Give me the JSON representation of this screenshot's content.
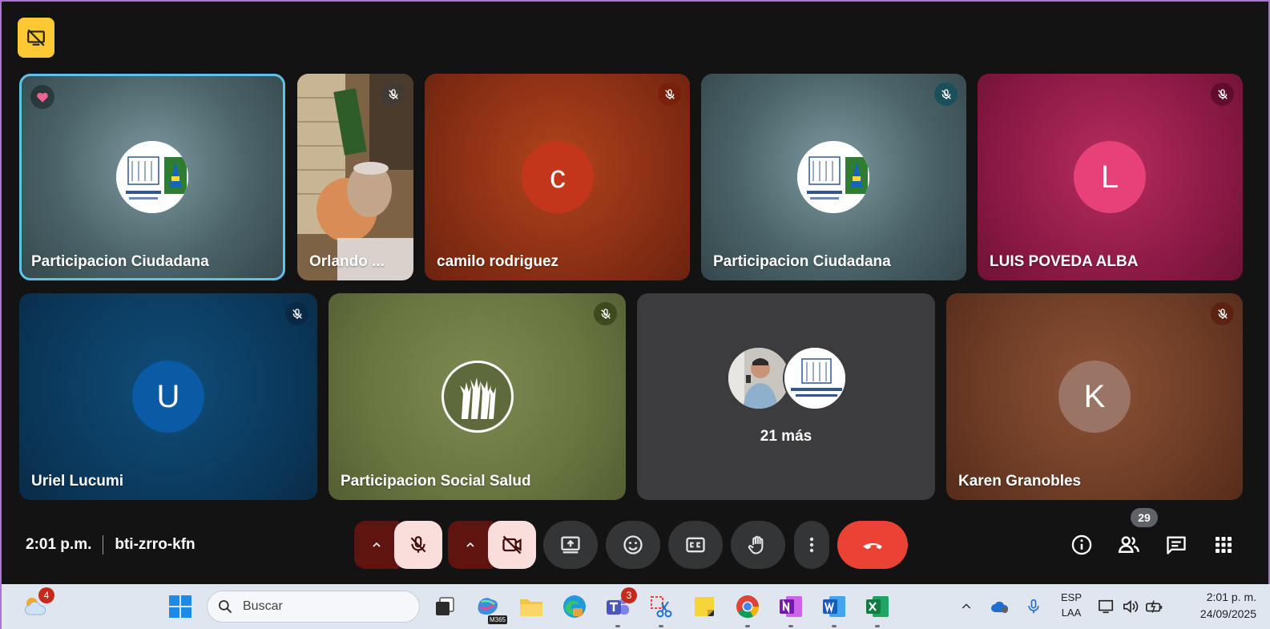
{
  "tiles": [
    {
      "name": "Participacion Ciudadana"
    },
    {
      "name": "Orlando ..."
    },
    {
      "name": "camilo rodriguez",
      "initial": "c"
    },
    {
      "name": "Participacion Ciudadana"
    },
    {
      "name": "LUIS POVEDA ALBA",
      "initial": "L"
    },
    {
      "name": "Uriel Lucumi",
      "initial": "U"
    },
    {
      "name": "Participacion Social Salud"
    },
    {
      "name": "",
      "more": "21 más"
    },
    {
      "name": "Karen Granobles",
      "initial": "K"
    }
  ],
  "meeting": {
    "time": "2:01 p.m.",
    "code": "bti-zrro-kfn",
    "participants_count": "29"
  },
  "taskbar": {
    "weather_badge": "4",
    "search_placeholder": "Buscar",
    "teams_badge": "3",
    "m365_label": "M365",
    "lang_top": "ESP",
    "lang_bottom": "LAA",
    "clock_time": "2:01 p. m.",
    "clock_date": "24/09/2025"
  },
  "colors": {
    "accent": "#5ec1e8",
    "end_call": "#ea4335",
    "mic_off_bg": "#f9dedc",
    "highlight": "#fcc934"
  }
}
